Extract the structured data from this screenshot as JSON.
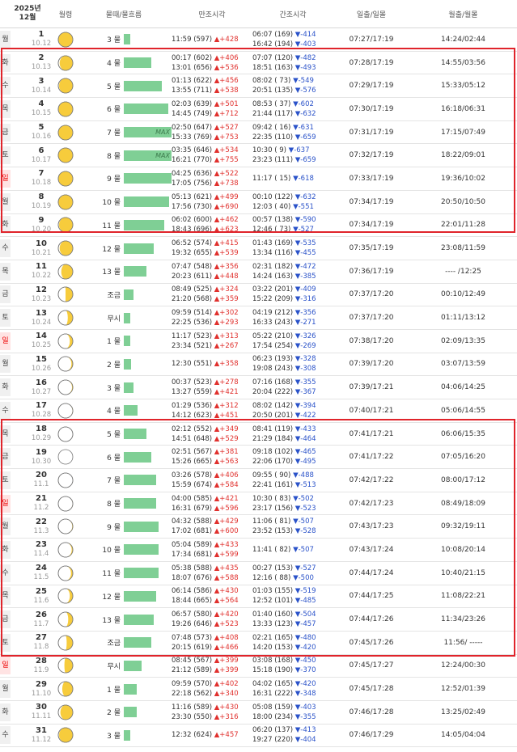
{
  "header": {
    "year_month": "2025년\n12월",
    "moon_phase": "월령",
    "tide_label": "물때/물흐름",
    "high_tide": "만조시각",
    "low_tide": "간조시각",
    "sun": "일출/일몰",
    "moon_rs": "월출/월몰"
  },
  "rows": [
    {
      "dow": "월",
      "sunday": false,
      "day": "1",
      "solar": "10.12",
      "phase": 0.95,
      "tide": "3 물",
      "bar": 0.07,
      "max": "",
      "h1": "11:59 (597)",
      "hd1": "▲+428",
      "h2": "",
      "hd2": "",
      "l1": "06:07 (169)",
      "ld1": "▼-414",
      "l2": "16:42 (194)",
      "ld2": "▼-403",
      "sun": "07:27/17:19",
      "moon": "14:24/02:44"
    },
    {
      "dow": "화",
      "sunday": false,
      "day": "2",
      "solar": "10.13",
      "phase": 0.8,
      "tide": "4 물",
      "bar": 0.55,
      "max": "",
      "h1": "00:17 (602)",
      "hd1": "▲+406",
      "h2": "13:01 (656)",
      "hd2": "▲+536",
      "l1": "07:07 (120)",
      "ld1": "▼-482",
      "l2": "18:51 (163)",
      "ld2": "▼-493",
      "sun": "07:28/17:19",
      "moon": "14:55/03:56"
    },
    {
      "dow": "수",
      "sunday": false,
      "day": "3",
      "solar": "10.14",
      "phase": 0.85,
      "tide": "5 물",
      "bar": 0.75,
      "max": "",
      "h1": "01:13 (622)",
      "hd1": "▲+456",
      "h2": "13:55 (711)",
      "hd2": "▲+538",
      "l1": "08:02 ( 73)",
      "ld1": "▼-549",
      "l2": "20:51 (135)",
      "ld2": "▼-576",
      "sun": "07:29/17:19",
      "moon": "15:33/05:12"
    },
    {
      "dow": "목",
      "sunday": false,
      "day": "4",
      "solar": "10.15",
      "phase": 0.9,
      "tide": "6 물",
      "bar": 0.88,
      "max": "",
      "h1": "02:03 (639)",
      "hd1": "▲+501",
      "h2": "14:45 (749)",
      "hd2": "▲+712",
      "l1": "08:53 ( 37)",
      "ld1": "▼-602",
      "l2": "21:44 (117)",
      "ld2": "▼-632",
      "sun": "07:30/17:19",
      "moon": "16:18/06:31"
    },
    {
      "dow": "금",
      "sunday": false,
      "day": "5",
      "solar": "10.16",
      "phase": 0.97,
      "tide": "7 물",
      "bar": 0.95,
      "max": "MAX",
      "h1": "02:50 (647)",
      "hd1": "▲+527",
      "h2": "15:33 (769)",
      "hd2": "▲+753",
      "l1": "09:42 ( 16)",
      "ld1": "▼-631",
      "l2": "22:35 (110)",
      "ld2": "▼-659",
      "sun": "07:31/17:19",
      "moon": "17:15/07:49"
    },
    {
      "dow": "토",
      "sunday": false,
      "day": "6",
      "solar": "10.17",
      "phase": 1.0,
      "tide": "8 물",
      "bar": 0.95,
      "max": "MAX",
      "h1": "03:35 (646)",
      "hd1": "▲+534",
      "h2": "16:21 (770)",
      "hd2": "▲+755",
      "l1": "10:30 (  9)",
      "ld1": "▼-637",
      "l2": "23:23 (111)",
      "ld2": "▼-659",
      "sun": "07:32/17:19",
      "moon": "18:22/09:01"
    },
    {
      "dow": "일",
      "sunday": true,
      "day": "7",
      "solar": "10.18",
      "phase": 0.95,
      "tide": "9 물",
      "bar": 0.95,
      "max": "",
      "h1": "04:25 (636)",
      "hd1": "▲+522",
      "h2": "17:05 (756)",
      "hd2": "▲+738",
      "l1": "11:17 ( 15)",
      "ld1": "▼-618",
      "l2": "",
      "ld2": "",
      "sun": "07:33/17:19",
      "moon": "19:36/10:02"
    },
    {
      "dow": "월",
      "sunday": false,
      "day": "8",
      "solar": "10.19",
      "phase": 0.9,
      "tide": "10 물",
      "bar": 0.9,
      "max": "",
      "h1": "05:13 (621)",
      "hd1": "▲+499",
      "h2": "17:56 (730)",
      "hd2": "▲+690",
      "l1": "00:10 (122)",
      "ld1": "▼-632",
      "l2": "12:03 ( 40)",
      "ld2": "▼-551",
      "sun": "07:34/17:19",
      "moon": "20:50/10:50"
    },
    {
      "dow": "화",
      "sunday": false,
      "day": "9",
      "solar": "10.20",
      "phase": 0.85,
      "tide": "11 물",
      "bar": 0.8,
      "max": "",
      "h1": "06:02 (600)",
      "hd1": "▲+462",
      "h2": "18:43 (696)",
      "hd2": "▲+623",
      "l1": "00:57 (138)",
      "ld1": "▼-590",
      "l2": "12:46 ( 73)",
      "ld2": "▼-527",
      "sun": "07:34/17:19",
      "moon": "22:01/11:28"
    },
    {
      "dow": "수",
      "sunday": false,
      "day": "10",
      "solar": "10.21",
      "phase": 0.8,
      "tide": "12 물",
      "bar": 0.6,
      "max": "",
      "h1": "06:52 (574)",
      "hd1": "▲+415",
      "h2": "19:32 (655)",
      "hd2": "▲+539",
      "l1": "01:43 (169)",
      "ld1": "▼-535",
      "l2": "13:34 (116)",
      "ld2": "▼-455",
      "sun": "07:35/17:19",
      "moon": "23:08/11:59"
    },
    {
      "dow": "목",
      "sunday": false,
      "day": "11",
      "solar": "10.22",
      "phase": 0.7,
      "tide": "13 물",
      "bar": 0.45,
      "max": "",
      "h1": "07:47 (548)",
      "hd1": "▲+356",
      "h2": "20:23 (611)",
      "hd2": "▲+448",
      "l1": "02:31 (182)",
      "ld1": "▼-472",
      "l2": "14:24 (163)",
      "ld2": "▼-385",
      "sun": "07:36/17:19",
      "moon": "---- /12:25"
    },
    {
      "dow": "금",
      "sunday": false,
      "day": "12",
      "solar": "10.23",
      "phase": 0.5,
      "tide": "조금",
      "bar": 0.2,
      "max": "",
      "h1": "08:49 (525)",
      "hd1": "▲+324",
      "h2": "21:20 (568)",
      "hd2": "▲+359",
      "l1": "03:22 (201)",
      "ld1": "▼-409",
      "l2": "15:22 (209)",
      "ld2": "▼-316",
      "sun": "07:37/17:20",
      "moon": "00:10/12:49"
    },
    {
      "dow": "토",
      "sunday": false,
      "day": "13",
      "solar": "10.24",
      "phase": 0.4,
      "tide": "무시",
      "bar": 0.1,
      "max": "",
      "h1": "09:59 (514)",
      "hd1": "▲+302",
      "h2": "22:25 (536)",
      "hd2": "▲+293",
      "l1": "04:19 (212)",
      "ld1": "▼-356",
      "l2": "16:33 (243)",
      "ld2": "▼-271",
      "sun": "07:37/17:20",
      "moon": "01:11/13:12"
    },
    {
      "dow": "일",
      "sunday": true,
      "day": "14",
      "solar": "10.25",
      "phase": 0.3,
      "tide": "1 물",
      "bar": 0.1,
      "max": "",
      "h1": "11:17 (523)",
      "hd1": "▲+313",
      "h2": "23:34 (521)",
      "hd2": "▲+267",
      "l1": "05:22 (210)",
      "ld1": "▼-326",
      "l2": "17:54 (254)",
      "ld2": "▼-269",
      "sun": "07:38/17:20",
      "moon": "02:09/13:35"
    },
    {
      "dow": "월",
      "sunday": false,
      "day": "15",
      "solar": "10.26",
      "phase": 0.2,
      "tide": "2 물",
      "bar": 0.15,
      "max": "",
      "h1": "12:30 (551)",
      "hd1": "▲+358",
      "h2": "",
      "hd2": "",
      "l1": "06:23 (193)",
      "ld1": "▼-328",
      "l2": "19:08 (243)",
      "ld2": "▼-308",
      "sun": "07:39/17:20",
      "moon": "03:07/13:59"
    },
    {
      "dow": "화",
      "sunday": false,
      "day": "16",
      "solar": "10.27",
      "phase": 0.15,
      "tide": "3 물",
      "bar": 0.2,
      "max": "",
      "h1": "00:37 (523)",
      "hd1": "▲+278",
      "h2": "13:27 (559)",
      "hd2": "▲+421",
      "l1": "07:16 (168)",
      "ld1": "▼-355",
      "l2": "20:04 (222)",
      "ld2": "▼-367",
      "sun": "07:39/17:21",
      "moon": "04:06/14:25"
    },
    {
      "dow": "수",
      "sunday": false,
      "day": "17",
      "solar": "10.28",
      "phase": 0.1,
      "tide": "4 물",
      "bar": 0.28,
      "max": "",
      "h1": "01:29 (536)",
      "hd1": "▲+312",
      "h2": "14:12 (623)",
      "hd2": "▲+451",
      "l1": "08:02 (142)",
      "ld1": "▼-394",
      "l2": "20:50 (201)",
      "ld2": "▼-422",
      "sun": "07:40/17:21",
      "moon": "05:06/14:55"
    },
    {
      "dow": "목",
      "sunday": false,
      "day": "18",
      "solar": "10.29",
      "phase": 0.05,
      "tide": "5 물",
      "bar": 0.45,
      "max": "",
      "h1": "02:12 (552)",
      "hd1": "▲+349",
      "h2": "14:51 (648)",
      "hd2": "▲+529",
      "l1": "08:41 (119)",
      "ld1": "▼-433",
      "l2": "21:29 (184)",
      "ld2": "▼-464",
      "sun": "07:41/17:21",
      "moon": "06:06/15:35"
    },
    {
      "dow": "금",
      "sunday": false,
      "day": "19",
      "solar": "10.30",
      "phase": 0.0,
      "tide": "6 물",
      "bar": 0.55,
      "max": "",
      "h1": "02:51 (567)",
      "hd1": "▲+381",
      "h2": "15:26 (665)",
      "hd2": "▲+563",
      "l1": "09:18 (102)",
      "ld1": "▼-465",
      "l2": "22:06 (170)",
      "ld2": "▼-495",
      "sun": "07:41/17:22",
      "moon": "07:05/16:20"
    },
    {
      "dow": "토",
      "sunday": false,
      "day": "20",
      "solar": "11.1",
      "phase": 0.03,
      "tide": "7 물",
      "bar": 0.65,
      "max": "",
      "h1": "03:26 (578)",
      "hd1": "▲+406",
      "h2": "15:59 (674)",
      "hd2": "▲+584",
      "l1": "09:55 ( 90)",
      "ld1": "▼-488",
      "l2": "22:41 (161)",
      "ld2": "▼-513",
      "sun": "07:42/17:22",
      "moon": "08:00/17:12"
    },
    {
      "dow": "일",
      "sunday": true,
      "day": "21",
      "solar": "11.2",
      "phase": 0.08,
      "tide": "8 물",
      "bar": 0.65,
      "max": "",
      "h1": "04:00 (585)",
      "hd1": "▲+421",
      "h2": "16:31 (679)",
      "hd2": "▲+596",
      "l1": "10:30 ( 83)",
      "ld1": "▼-502",
      "l2": "23:17 (156)",
      "ld2": "▼-523",
      "sun": "07:42/17:23",
      "moon": "08:49/18:09"
    },
    {
      "dow": "월",
      "sunday": false,
      "day": "22",
      "solar": "11.3",
      "phase": 0.13,
      "tide": "9 물",
      "bar": 0.7,
      "max": "",
      "h1": "04:32 (588)",
      "hd1": "▲+429",
      "h2": "17:02 (681)",
      "hd2": "▲+600",
      "l1": "11:06 ( 81)",
      "ld1": "▼-507",
      "l2": "23:52 (153)",
      "ld2": "▼-528",
      "sun": "07:43/17:23",
      "moon": "09:32/19:11"
    },
    {
      "dow": "화",
      "sunday": false,
      "day": "23",
      "solar": "11.4",
      "phase": 0.18,
      "tide": "10 물",
      "bar": 0.7,
      "max": "",
      "h1": "05:04 (589)",
      "hd1": "▲+433",
      "h2": "17:34 (681)",
      "hd2": "▲+599",
      "l1": "11:41 ( 82)",
      "ld1": "▼-507",
      "l2": "",
      "ld2": "",
      "sun": "07:43/17:24",
      "moon": "10:08/20:14"
    },
    {
      "dow": "수",
      "sunday": false,
      "day": "24",
      "solar": "11.5",
      "phase": 0.23,
      "tide": "11 물",
      "bar": 0.7,
      "max": "",
      "h1": "05:38 (588)",
      "hd1": "▲+435",
      "h2": "18:07 (676)",
      "hd2": "▲+588",
      "l1": "00:27 (153)",
      "ld1": "▼-527",
      "l2": "12:16 ( 88)",
      "ld2": "▼-500",
      "sun": "07:44/17:24",
      "moon": "10:40/21:15"
    },
    {
      "dow": "목",
      "sunday": false,
      "day": "25",
      "solar": "11.6",
      "phase": 0.3,
      "tide": "12 물",
      "bar": 0.65,
      "max": "",
      "h1": "06:14 (586)",
      "hd1": "▲+430",
      "h2": "18:44 (665)",
      "hd2": "▲+564",
      "l1": "01:03 (155)",
      "ld1": "▼-519",
      "l2": "12:52 (101)",
      "ld2": "▼-485",
      "sun": "07:44/17:25",
      "moon": "11:08/22:21"
    },
    {
      "dow": "금",
      "sunday": false,
      "day": "26",
      "solar": "11.7",
      "phase": 0.38,
      "tide": "13 물",
      "bar": 0.6,
      "max": "",
      "h1": "06:57 (580)",
      "hd1": "▲+420",
      "h2": "19:26 (646)",
      "hd2": "▲+523",
      "l1": "01:40 (160)",
      "ld1": "▼-504",
      "l2": "13:33 (123)",
      "ld2": "▼-457",
      "sun": "07:44/17:26",
      "moon": "11:34/23:26"
    },
    {
      "dow": "토",
      "sunday": false,
      "day": "27",
      "solar": "11.8",
      "phase": 0.45,
      "tide": "조금",
      "bar": 0.55,
      "max": "",
      "h1": "07:48 (573)",
      "hd1": "▲+408",
      "h2": "20:15 (619)",
      "hd2": "▲+466",
      "l1": "02:21 (165)",
      "ld1": "▼-480",
      "l2": "14:20 (153)",
      "ld2": "▼-420",
      "sun": "07:45/17:26",
      "moon": "11:56/ -----"
    },
    {
      "dow": "일",
      "sunday": true,
      "day": "28",
      "solar": "11.9",
      "phase": 0.55,
      "tide": "무시",
      "bar": 0.35,
      "max": "",
      "h1": "08:45 (567)",
      "hd1": "▲+399",
      "h2": "21:12 (589)",
      "hd2": "▲+399",
      "l1": "03:08 (168)",
      "ld1": "▼-450",
      "l2": "15:18 (190)",
      "ld2": "▼-370",
      "sun": "07:45/17:27",
      "moon": "12:24/00:30"
    },
    {
      "dow": "월",
      "sunday": false,
      "day": "29",
      "solar": "11.10",
      "phase": 0.65,
      "tide": "1 물",
      "bar": 0.25,
      "max": "",
      "h1": "09:59 (570)",
      "hd1": "▲+402",
      "h2": "22:18 (562)",
      "hd2": "▲+340",
      "l1": "04:02 (165)",
      "ld1": "▼-420",
      "l2": "16:31 (222)",
      "ld2": "▼-348",
      "sun": "07:45/17:28",
      "moon": "12:52/01:39"
    },
    {
      "dow": "화",
      "sunday": false,
      "day": "30",
      "solar": "11.11",
      "phase": 0.75,
      "tide": "2 물",
      "bar": 0.25,
      "max": "",
      "h1": "11:16 (589)",
      "hd1": "▲+430",
      "h2": "23:30 (550)",
      "hd2": "▲+316",
      "l1": "05:08 (159)",
      "ld1": "▼-403",
      "l2": "18:00 (234)",
      "ld2": "▼-355",
      "sun": "07:46/17:28",
      "moon": "13:25/02:49"
    },
    {
      "dow": "수",
      "sunday": false,
      "day": "31",
      "solar": "11.12",
      "phase": 0.85,
      "tide": "3 물",
      "bar": 0.1,
      "max": "",
      "h1": "12:32 (624)",
      "hd1": "▲+457",
      "h2": "",
      "hd2": "",
      "l1": "06:20 (137)",
      "ld1": "▼-413",
      "l2": "19:27 (220)",
      "ld2": "▼-404",
      "sun": "07:46/17:29",
      "moon": "14:05/04:04"
    }
  ]
}
